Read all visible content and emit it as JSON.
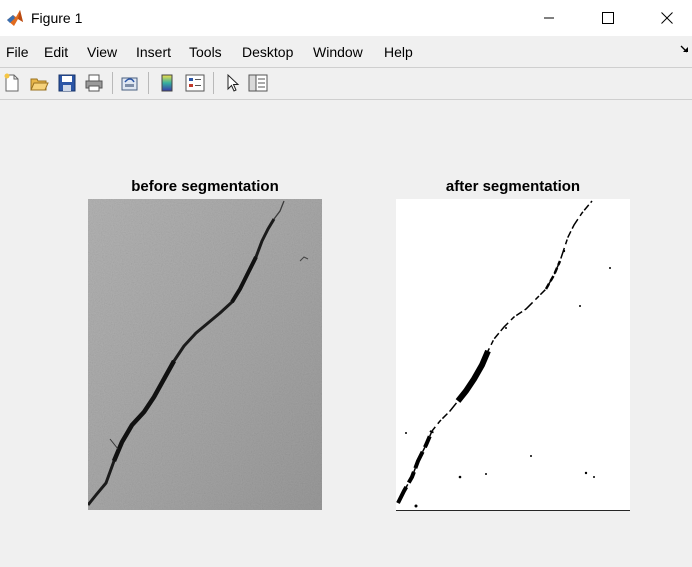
{
  "window": {
    "title": "Figure 1"
  },
  "menubar": {
    "items": [
      "File",
      "Edit",
      "View",
      "Insert",
      "Tools",
      "Desktop",
      "Window",
      "Help"
    ]
  },
  "toolbar": {
    "icons": [
      "new-figure-icon",
      "open-file-icon",
      "save-icon",
      "print-icon",
      "link-plot-icon",
      "colorbar-icon",
      "legend-icon",
      "edit-plot-arrow-icon",
      "property-inspector-icon"
    ]
  },
  "plots": {
    "left": {
      "title": "before segmentation"
    },
    "right": {
      "title": "after segmentation"
    }
  },
  "colors": {
    "titlebar": "#ffffff",
    "background": "#f0f0f0",
    "concrete": "#a9a9a9",
    "crack": "#1c1c1c"
  }
}
